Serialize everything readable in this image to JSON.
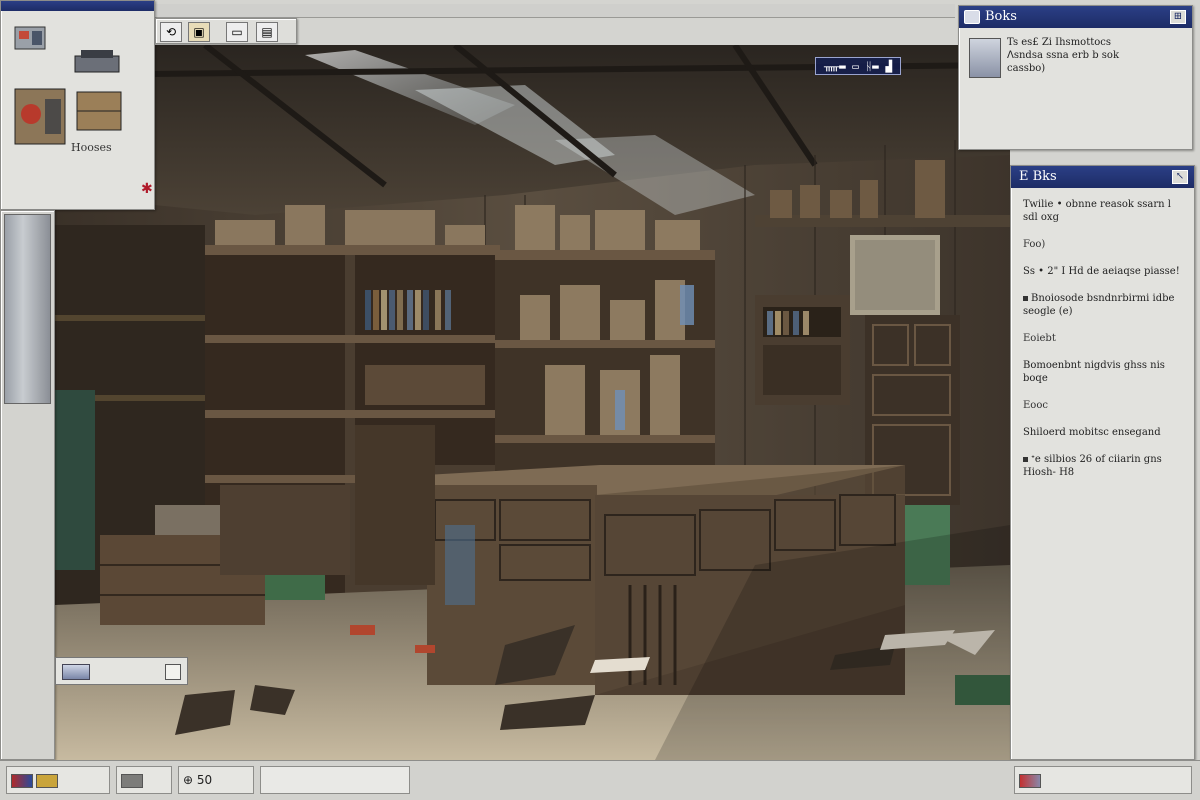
{
  "inventory": {
    "label": "Hooses",
    "mark": "✱"
  },
  "top_toolbar": {
    "buttons": [
      "⟲",
      "▣",
      "▭",
      "▤"
    ]
  },
  "minimap": {
    "label": "ᚅ▬ ▭ ᚺ▬ ▟"
  },
  "quest_panel": {
    "title": "Boks",
    "lines": [
      "Ts es£ Zi Ihsmottocs",
      "ᐱsndsa ssna erb b sok",
      "cassbo)"
    ]
  },
  "log_panel": {
    "title": "E Bks",
    "entries": [
      {
        "head": "",
        "text": "Twilie • obnne reasok ssarn l sdl oxg"
      },
      {
        "head": "Foo)",
        "text": ""
      },
      {
        "head": "",
        "text": "Ss • 2\" I Hd de aeiaqse piasse!"
      },
      {
        "head": "",
        "text": "Bnoiosode bsndnrbirmi idbe seogle (e)"
      },
      {
        "head": "Eoiebt",
        "text": ""
      },
      {
        "head": "",
        "text": "Bomoenbnt nigdvis ghss nis boqe"
      },
      {
        "head": "Eooc",
        "text": ""
      },
      {
        "head": "",
        "text": "Shiloerd mobitsc ensegand"
      },
      {
        "head": "",
        "text": "ᐩe silbios 26 of ciiarin gns Hiosh- H8"
      }
    ]
  },
  "status_bar": {
    "cells": [
      "",
      "",
      "⊕ 50",
      "",
      ""
    ]
  }
}
